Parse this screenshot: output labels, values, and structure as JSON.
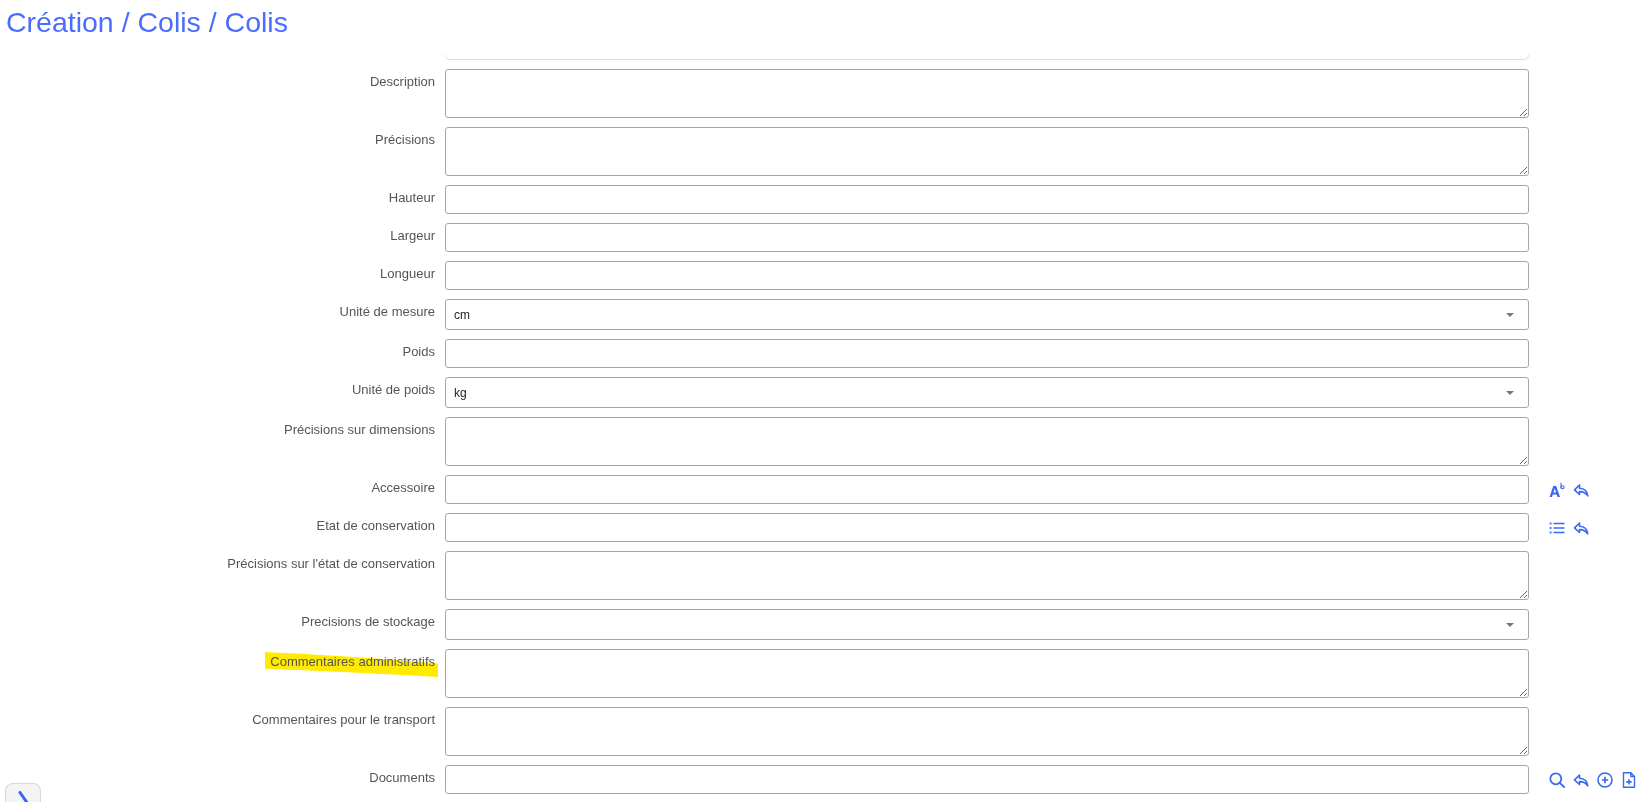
{
  "header": {
    "title": "Création / Colis / Colis"
  },
  "fields": [
    {
      "label": "Description",
      "kind": "textarea",
      "highlighted": false
    },
    {
      "label": "Précisions",
      "kind": "textarea",
      "highlighted": false
    },
    {
      "label": "Hauteur",
      "kind": "text",
      "highlighted": false
    },
    {
      "label": "Largeur",
      "kind": "text",
      "highlighted": false
    },
    {
      "label": "Longueur",
      "kind": "text",
      "highlighted": false
    },
    {
      "label": "Unité de mesure",
      "kind": "select",
      "value": "cm",
      "highlighted": false
    },
    {
      "label": "Poids",
      "kind": "text",
      "highlighted": false
    },
    {
      "label": "Unité de poids",
      "kind": "select",
      "value": "kg",
      "highlighted": false
    },
    {
      "label": "Précisions sur dimensions",
      "kind": "textarea",
      "highlighted": false
    },
    {
      "label": "Accessoire",
      "kind": "text",
      "highlighted": false,
      "actions": [
        {
          "kind": "superscript"
        },
        {
          "kind": "undo"
        }
      ]
    },
    {
      "label": "Etat de conservation",
      "kind": "text",
      "highlighted": false,
      "actions": [
        {
          "kind": "list"
        },
        {
          "kind": "undo"
        }
      ]
    },
    {
      "label": "Précisions sur l'état de conservation",
      "kind": "textarea",
      "highlighted": false
    },
    {
      "label": "Precisions de stockage",
      "kind": "select",
      "highlighted": false
    },
    {
      "label": "Commentaires administratifs",
      "kind": "textarea",
      "highlighted": true
    },
    {
      "label": "Commentaires pour le transport",
      "kind": "textarea",
      "highlighted": false
    },
    {
      "label": "Documents",
      "kind": "text",
      "highlighted": false,
      "actions": [
        {
          "kind": "search"
        },
        {
          "kind": "undo"
        },
        {
          "kind": "add"
        },
        {
          "kind": "new-file"
        }
      ]
    }
  ]
}
